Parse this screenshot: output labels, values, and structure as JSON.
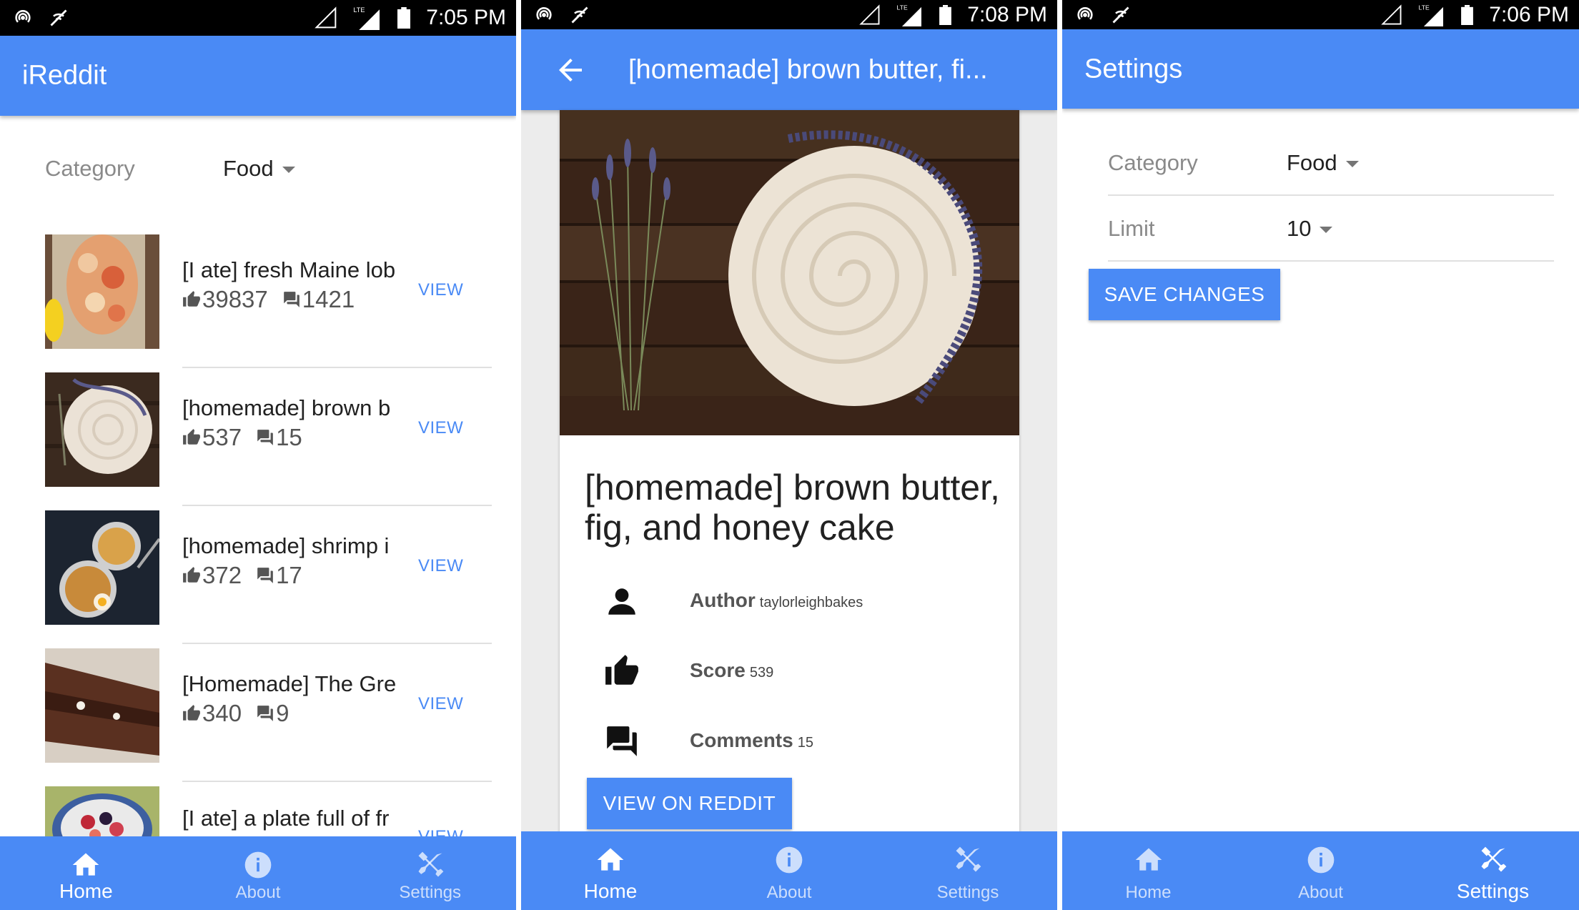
{
  "status_bars": [
    {
      "time": "7:05 PM"
    },
    {
      "time": "7:08 PM"
    },
    {
      "time": "7:06 PM"
    }
  ],
  "bottom_nav": {
    "home": "Home",
    "about": "About",
    "settings": "Settings"
  },
  "home_screen": {
    "app_title": "iReddit",
    "category_label": "Category",
    "category_value": "Food",
    "view_label": "VIEW",
    "posts": [
      {
        "title": "[I ate] fresh Maine lob",
        "score": "39837",
        "comments": "1421"
      },
      {
        "title": "[homemade] brown b",
        "score": "537",
        "comments": "15"
      },
      {
        "title": "[homemade] shrimp i",
        "score": "372",
        "comments": "17"
      },
      {
        "title": "[Homemade] The Gre",
        "score": "340",
        "comments": "9"
      },
      {
        "title": "[I ate] a plate full of fr",
        "score": "",
        "comments": ""
      }
    ]
  },
  "detail_screen": {
    "appbar_title": "[homemade] brown butter, fi...",
    "title": "[homemade] brown butter, fig, and honey cake",
    "author_label": "Author",
    "author_value": "taylorleighbakes",
    "score_label": "Score",
    "score_value": "539",
    "comments_label": "Comments",
    "comments_value": "15",
    "button": "VIEW ON REDDIT"
  },
  "settings_screen": {
    "title": "Settings",
    "category_label": "Category",
    "category_value": "Food",
    "limit_label": "Limit",
    "limit_value": "10",
    "button": "SAVE CHANGES"
  },
  "colors": {
    "primary": "#4a8af5",
    "status_bar": "#000000",
    "text_secondary": "#8a8a8a"
  }
}
